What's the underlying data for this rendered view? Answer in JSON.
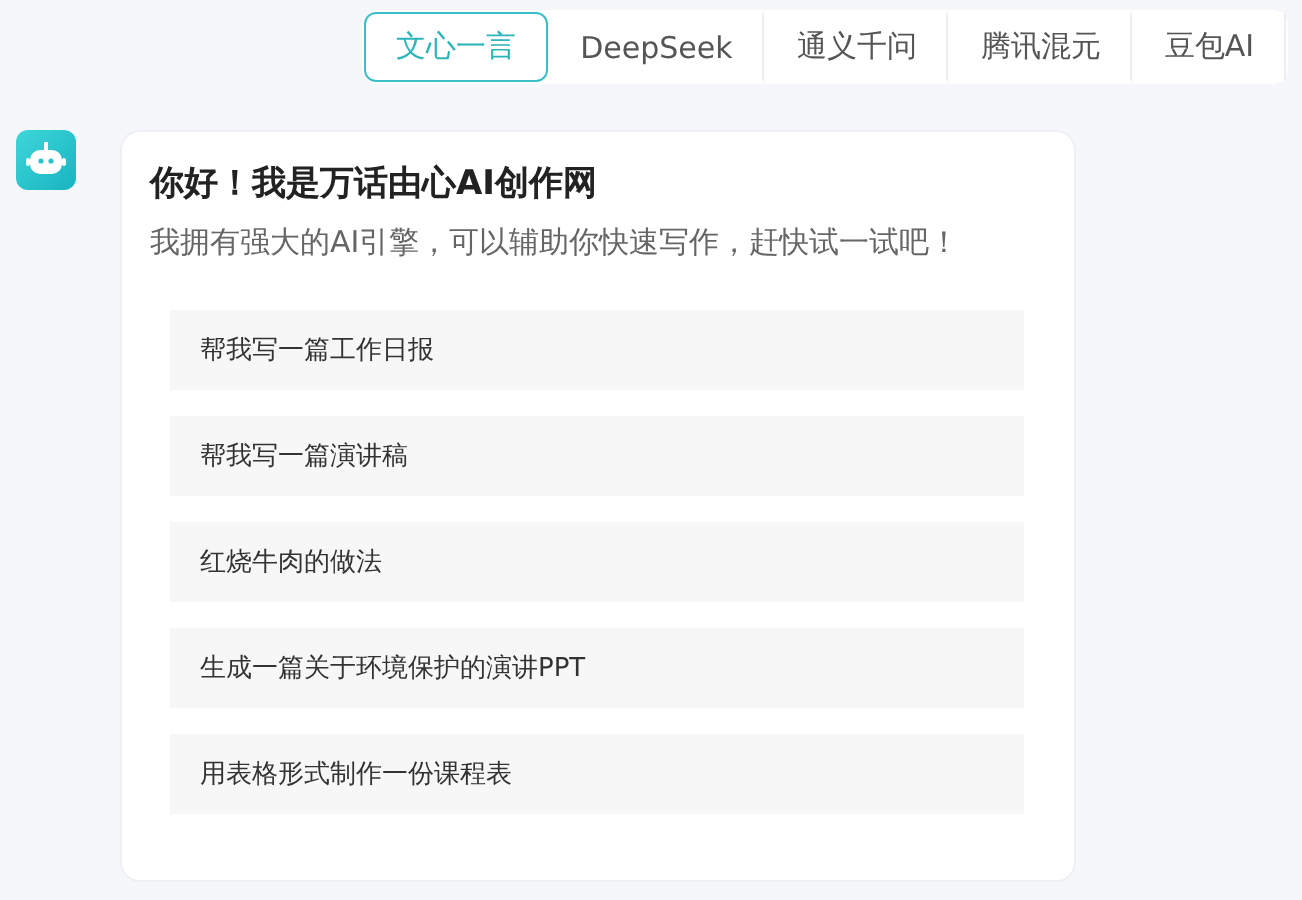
{
  "model_tabs": [
    {
      "label": "文心一言",
      "selected": true
    },
    {
      "label": "DeepSeek",
      "selected": false
    },
    {
      "label": "通义千问",
      "selected": false
    },
    {
      "label": "腾讯混元",
      "selected": false
    },
    {
      "label": "豆包AI",
      "selected": false
    }
  ],
  "message": {
    "title": "你好！我是万话由心AI创作网",
    "subtitle": "我拥有强大的AI引擎，可以辅助你快速写作，赶快试一试吧！",
    "suggestions": [
      "帮我写一篇工作日报",
      "帮我写一篇演讲稿",
      "红烧牛肉的做法",
      "生成一篇关于环境保护的演讲PPT",
      "用表格形式制作一份课程表"
    ]
  }
}
